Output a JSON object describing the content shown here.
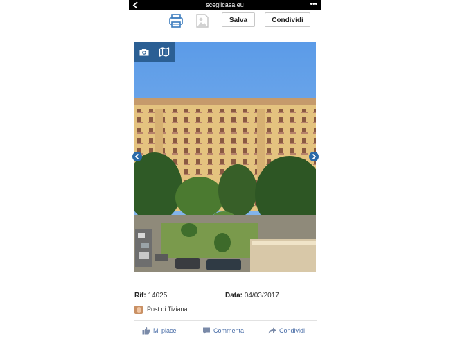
{
  "browser": {
    "url": "sceglicasa.eu",
    "more_label": "•••"
  },
  "toolbar": {
    "save_label": "Salva",
    "share_label": "Condividi"
  },
  "listing": {
    "rif_label": "Rif:",
    "rif_value": "14025",
    "data_label": "Data:",
    "data_value": "04/03/2017"
  },
  "author": {
    "name": "Post di Tiziana"
  },
  "actions": {
    "like_label": "Mi piace",
    "comment_label": "Commenta",
    "share_label": "Condividi"
  },
  "colors": {
    "accent": "#2b5f94",
    "action_text": "#4a6ea8",
    "topbar": "#000000"
  },
  "icons": {
    "back": "chevron-left-icon",
    "print": "printer-icon",
    "photo": "photo-frame-icon",
    "camera": "camera-icon",
    "map": "map-icon",
    "like": "thumbs-up-icon",
    "comment": "comment-icon",
    "share": "share-arrow-icon"
  }
}
